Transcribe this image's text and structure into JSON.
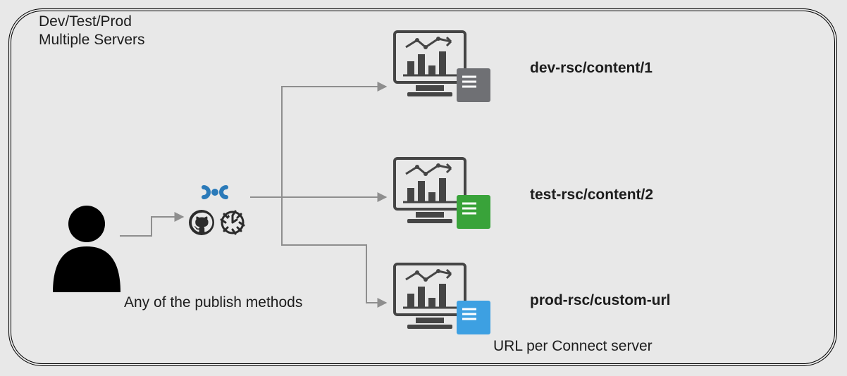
{
  "header": {
    "title_line1": "Dev/Test/Prod",
    "title_line2": "Multiple Servers"
  },
  "publish": {
    "caption": "Any of the publish methods"
  },
  "servers": [
    {
      "label": "dev-rsc/content/1",
      "color": "#6f7074"
    },
    {
      "label": "test-rsc/content/2",
      "color": "#39a33a"
    },
    {
      "label": "prod-rsc/custom-url",
      "color": "#3da0e2"
    }
  ],
  "footer": {
    "caption": "URL per Connect server"
  },
  "icons": {
    "rstudio": "rstudio-icon",
    "github": "github-icon",
    "gears": "gears-icon"
  },
  "colors": {
    "arrow": "#8e8e8e",
    "stroke_dark": "#2b2b2b",
    "rstudio_blue": "#2a7ab9"
  }
}
